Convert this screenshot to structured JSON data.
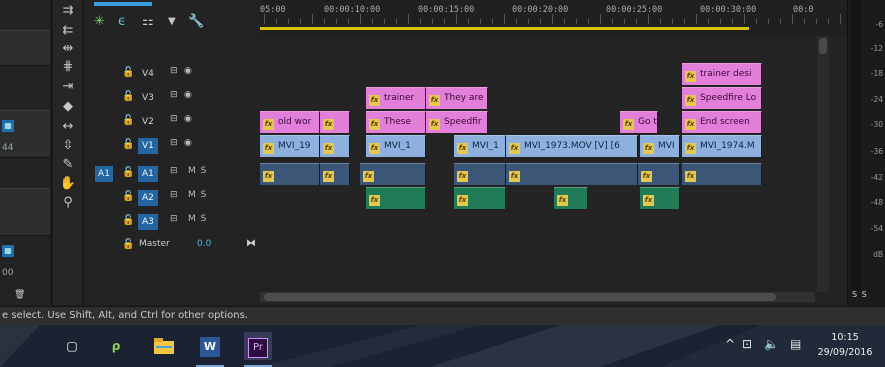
{
  "left_strip": {
    "labels": [
      "44",
      "00"
    ]
  },
  "timeline": {
    "ruler": [
      "05:00",
      "00:00:10:00",
      "00:00:15:00",
      "00:00:20:00",
      "00:00:25:00",
      "00:00:30:00",
      "00:0"
    ],
    "tracks": {
      "v4": "V4",
      "v3": "V3",
      "v2": "V2",
      "v1": "V1",
      "a1_src": "A1",
      "a1": "A1",
      "a2": "A2",
      "a3": "A3",
      "audio_flags": "M  S",
      "master_label": "Master",
      "master_value": "0.0"
    },
    "clips": {
      "v4_c1": "trainer desi",
      "v3_c1": "trainer",
      "v3_c2": "They are",
      "v3_c3": "Speedfire Lo",
      "v2_c1": "old wor",
      "v2_c2": "",
      "v2_c3": "These",
      "v2_c4": "Speedfir",
      "v2_c5": "Go twi",
      "v2_c6": "End screen",
      "v1_c1": "MVI_19",
      "v1_c2": "",
      "v1_c3": "MVI_1",
      "v1_c4": "MVI_1",
      "v1_c5": "MVI_1973.MOV [V] [6",
      "v1_c6": "MVI",
      "v1_c7": "MVI_1974.M"
    }
  },
  "meter": {
    "ticks": [
      "-6",
      "-12",
      "-18",
      "-24",
      "-30",
      "-36",
      "-42",
      "-48",
      "-54",
      "dB"
    ],
    "solo": "S S"
  },
  "status": {
    "text": "e select. Use Shift, Alt, and Ctrl for other options."
  },
  "taskbar": {
    "time": "10:15",
    "date": "29/09/2016",
    "premiere_label": "Pr",
    "word_label": "W"
  },
  "colors": {
    "video_clip": "#8db0df",
    "title_clip": "#e27fd9",
    "audio_clip": "#1f7c57",
    "work_area": "#d9c200"
  }
}
